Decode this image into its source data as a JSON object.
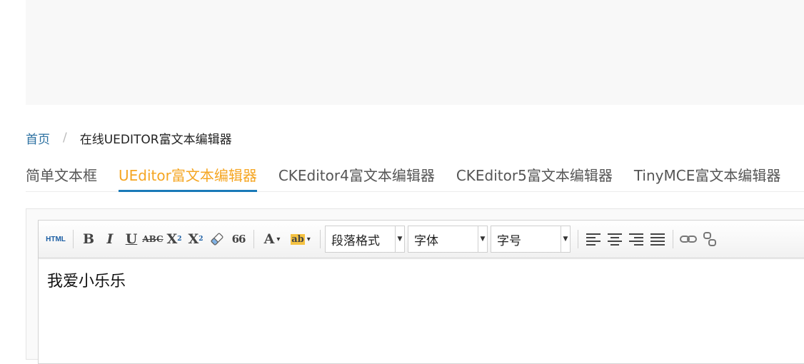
{
  "breadcrumb": {
    "home": "首页",
    "separator": "/",
    "current": "在线UEDITOR富文本编辑器"
  },
  "tabs": [
    {
      "label": "简单文本框",
      "active": false
    },
    {
      "label": "UEditor富文本编辑器",
      "active": true
    },
    {
      "label": "CKEditor4富文本编辑器",
      "active": false
    },
    {
      "label": "CKEditor5富文本编辑器",
      "active": false
    },
    {
      "label": "TinyMCE富文本编辑器",
      "active": false
    }
  ],
  "toolbar": {
    "html_label": "HTML",
    "bold": "B",
    "italic": "I",
    "underline": "U",
    "strike": "ABC",
    "superscript_base": "X",
    "superscript_mark": "2",
    "subscript_base": "X",
    "subscript_mark": "2",
    "quote": "66",
    "font_color": "A",
    "highlight": "ab",
    "paragraph_select": "段落格式",
    "font_select": "字体",
    "size_select": "字号"
  },
  "editor": {
    "content": "我爱小乐乐"
  },
  "colors": {
    "active_tab": "#f5a623",
    "tab_underline": "#1a7ab8",
    "breadcrumb_link": "#2a6fa0"
  }
}
